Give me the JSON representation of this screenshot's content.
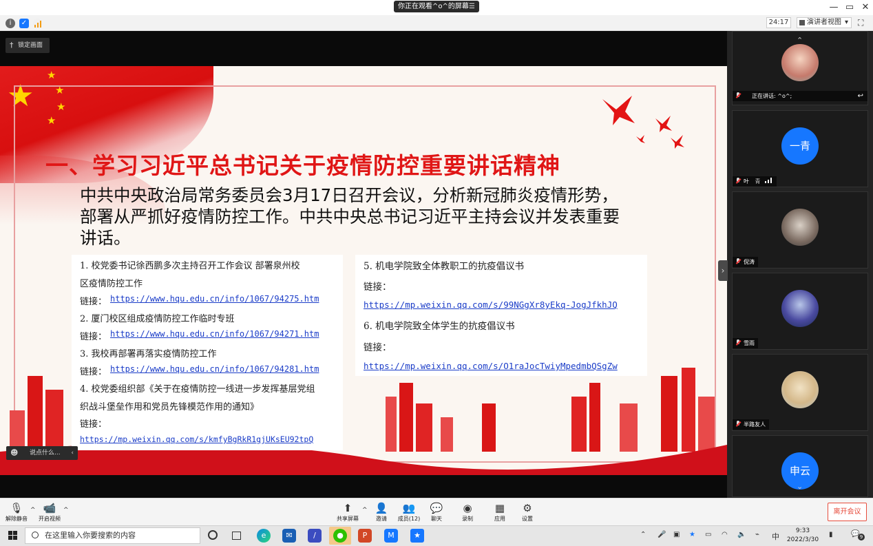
{
  "window": {
    "share_pill": "你正在观看^o^的屏幕",
    "share_menu": "☰",
    "minimize": "—",
    "restore": "▭",
    "close": "✕"
  },
  "toprow": {
    "timer": "24:17",
    "speaker_view": "演讲者视图",
    "speaker_view_caret": "▾",
    "fullscreen": "⛶"
  },
  "lock_screen": "锁定画面",
  "slide": {
    "title": "一、学习习近平总书记关于疫情防控重要讲话精神",
    "paragraph": "中共中央政治局常务委员会3月17日召开会议，分析新冠肺炎疫情形势，部署从严抓好疫情防控工作。中共中央总书记习近平主持会议并发表重要讲话。",
    "left_card": {
      "lines": [
        "1. 校党委书记徐西鹏多次主持召开工作会议 部署泉州校",
        "区疫情防控工作",
        "链接：",
        "2. 厦门校区组成疫情防控工作临时专班",
        "链接：",
        "3. 我校再部署再落实疫情防控工作",
        "链接：",
        "4. 校党委组织部《关于在疫情防控一线进一步发挥基层党组",
        "织战斗堡垒作用和党员先锋模范作用的通知》",
        "链接："
      ],
      "links": [
        "https://www.hqu.edu.cn/info/1067/94275.htm",
        "https://www.hqu.edu.cn/info/1067/94271.htm",
        "https://www.hqu.edu.cn/info/1067/94281.htm",
        "https://mp.weixin.qq.com/s/kmfyBgRkR1gjUKsEU92tpQ"
      ]
    },
    "right_card": {
      "lines": [
        "5. 机电学院致全体教职工的抗疫倡议书",
        "链接：",
        "6. 机电学院致全体学生的抗疫倡议书",
        "链接："
      ],
      "links": [
        "https://mp.weixin.qq.com/s/99NGgXr8yEkq-JogJfkhJQ",
        "https://mp.weixin.qq.com/s/O1raJocTwiyMpedmbQSgZw"
      ]
    }
  },
  "chat_input": {
    "placeholder": "说点什么...",
    "emoji": "☻",
    "chevron": "‹"
  },
  "participants": {
    "speaking_label": "正在讲话: ^o^;",
    "tiles": [
      {
        "name": "叶",
        "extra": "青",
        "avatar_text": "一青"
      },
      {
        "name": "倪涛",
        "avatar_text": ""
      },
      {
        "name": "雪雨",
        "avatar_text": ""
      },
      {
        "name": "半路友人",
        "avatar_text": ""
      },
      {
        "name": "",
        "avatar_text": "申云"
      }
    ],
    "collapse": "›",
    "scroll_up": "⌃",
    "scroll_down": "⌄"
  },
  "controls": {
    "unmute": "解除静音",
    "start_video": "开启视频",
    "share_screen": "共享屏幕",
    "invite": "邀请",
    "members": "成员(12)",
    "chat": "聊天",
    "record": "录制",
    "apps": "应用",
    "settings": "设置",
    "leave": "离开会议",
    "caret": "^"
  },
  "taskbar": {
    "search_placeholder": "在这里输入你要搜索的内容",
    "time": "9:33",
    "date": "2022/3/30",
    "ime": "中",
    "notification_count": "9"
  },
  "colors": {
    "slide_red": "#e01616",
    "link_blue": "#1a3cc8",
    "avatar_blue": "#1677ff",
    "leave_red": "#e74c3c"
  }
}
